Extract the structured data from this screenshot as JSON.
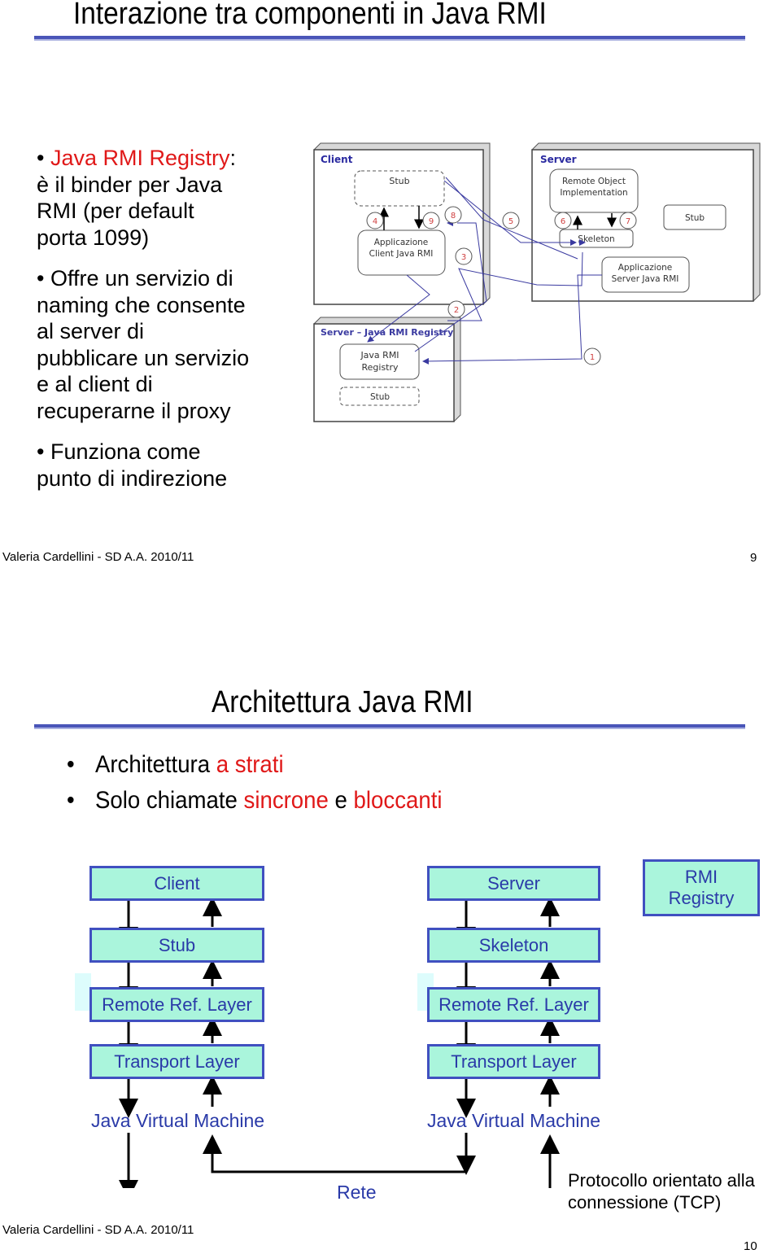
{
  "slide9": {
    "title": "Interazione tra componenti in Java RMI",
    "bullets": [
      {
        "highlight": "Java RMI Registry",
        "rest": ":",
        "lines": [
          "è il binder per Java",
          "RMI (per default",
          "porta 1099)"
        ]
      },
      {
        "lines": [
          "Offre un servizio di",
          "naming che consente",
          "al server di",
          "pubblicare un servizio",
          "e al client di",
          "recuperarne il proxy"
        ]
      },
      {
        "lines": [
          "Funziona come",
          "punto di indirezione"
        ]
      }
    ],
    "diagram": {
      "client_box": "Client",
      "server_box": "Server",
      "registry_box": "Server – Java RMI Registry",
      "client_stub": "Stub",
      "client_app": [
        "Applicazione",
        "Client Java RMI"
      ],
      "remote_object": [
        "Remote Object",
        "Implementation"
      ],
      "skeleton": "Skeleton",
      "server_stub": "Stub",
      "server_app": [
        "Applicazione",
        "Server Java RMI"
      ],
      "registry": [
        "Java RMI",
        "Registry"
      ],
      "registry_stub": "Stub",
      "steps": [
        "1",
        "2",
        "3",
        "4",
        "5",
        "6",
        "7",
        "8",
        "9"
      ]
    },
    "footer": "Valeria Cardellini - SD A.A. 2010/11",
    "page_number": "9"
  },
  "slide10": {
    "title": "Architettura Java RMI",
    "bullets": [
      {
        "parts": [
          {
            "text": "Architettura ",
            "red": false
          },
          {
            "text": "a strati",
            "red": true
          }
        ]
      },
      {
        "parts": [
          {
            "text": "Solo chiamate ",
            "red": false
          },
          {
            "text": "sincrone",
            "red": true
          },
          {
            "text": " e ",
            "red": false
          },
          {
            "text": "bloccanti",
            "red": true
          }
        ]
      }
    ],
    "client_stack": [
      "Client",
      "Stub",
      "Remote Ref. Layer",
      "Transport Layer",
      "Java Virtual Machine"
    ],
    "server_stack": [
      "Server",
      "Skeleton",
      "Remote Ref. Layer",
      "Transport Layer",
      "Java Virtual Machine"
    ],
    "registry_box": "RMI Registry",
    "network_label": "Rete",
    "protocol_note": [
      "Protocollo orientato alla",
      "connessione (TCP)"
    ],
    "footer": "Valeria Cardellini - SD A.A. 2010/11",
    "page_number": "10"
  },
  "colors": {
    "accent_red": "#e01818",
    "rule_blue": "#4a55b8",
    "layer_fill": "#aaf5dc",
    "layer_border": "#4050c0",
    "layer_text": "#2a3aa8",
    "diagram_link": "#3a3aa0",
    "step_text": "#d04040"
  }
}
